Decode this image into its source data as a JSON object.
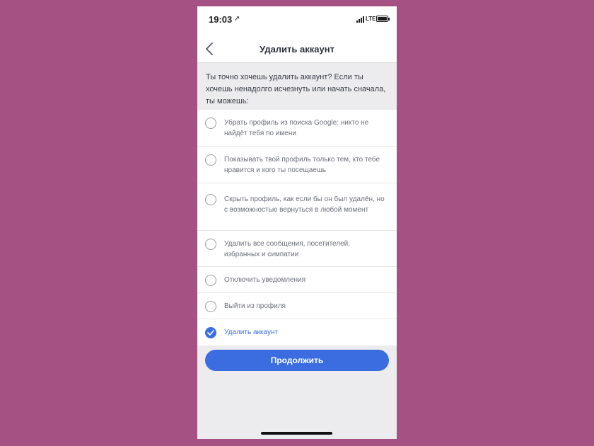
{
  "status": {
    "time": "19:03",
    "network": "LTE"
  },
  "nav": {
    "title": "Удалить аккаунт"
  },
  "intro": "Ты точно хочешь удалить аккаунт? Если ты хочешь ненадолго исчезнуть или начать сначала, ты можешь:",
  "options": [
    {
      "label": "Убрать профиль из поиска Google: никто не найдёт тебя по имени",
      "checked": false
    },
    {
      "label": "Показывать твой профиль только тем, кто тебе нравится и кого ты посещаешь",
      "checked": false
    },
    {
      "label": "Скрыть профиль, как если бы он был удалён, но с возможностью вернуться в любой момент",
      "checked": false
    },
    {
      "label": "Удалить все сообщения, посетителей, избранных и симпатии",
      "checked": false
    },
    {
      "label": "Отключить уведомления",
      "checked": false
    },
    {
      "label": "Выйти из профиля",
      "checked": false
    },
    {
      "label": "Удалить аккаунт",
      "checked": true
    }
  ],
  "continue_label": "Продолжить",
  "colors": {
    "accent": "#3b6de0",
    "background": "#a65184",
    "surface": "#ececee"
  }
}
